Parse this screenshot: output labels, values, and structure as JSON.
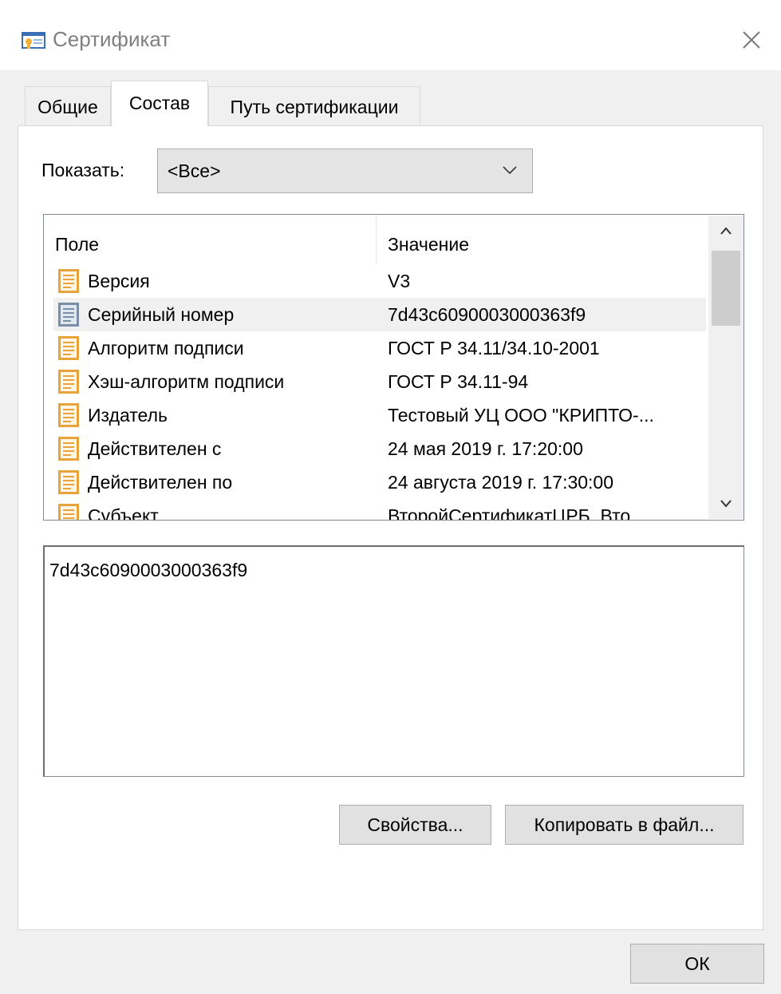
{
  "window": {
    "title": "Сертификат",
    "app_icon": "certificate-icon",
    "close_icon": "close-icon"
  },
  "tabs": [
    {
      "label": "Общие",
      "active": false
    },
    {
      "label": "Состав",
      "active": true
    },
    {
      "label": "Путь сертификации",
      "active": false
    }
  ],
  "show": {
    "label": "Показать:",
    "selected": "<Все>"
  },
  "table": {
    "columns": [
      "Поле",
      "Значение"
    ],
    "rows": [
      {
        "field": "Версия",
        "value": "V3",
        "selected": false
      },
      {
        "field": "Серийный номер",
        "value": "7d43c6090003000363f9",
        "selected": true
      },
      {
        "field": "Алгоритм подписи",
        "value": "ГОСТ Р 34.11/34.10-2001",
        "selected": false
      },
      {
        "field": "Хэш-алгоритм подписи",
        "value": "ГОСТ Р 34.11-94",
        "selected": false
      },
      {
        "field": "Издатель",
        "value": "Тестовый УЦ ООО \"КРИПТО-...",
        "selected": false
      },
      {
        "field": "Действителен с",
        "value": "24 мая 2019 г. 17:20:00",
        "selected": false
      },
      {
        "field": "Действителен по",
        "value": "24 августа 2019 г. 17:30:00",
        "selected": false
      },
      {
        "field": "Субъект",
        "value": "ВторойСертификатЦРБ, Вто...",
        "selected": false
      }
    ]
  },
  "detail": {
    "value": "7d43c6090003000363f9"
  },
  "buttons": {
    "properties": "Свойства...",
    "copy_to_file": "Копировать в файл...",
    "ok": "ОК"
  },
  "colors": {
    "window_bg": "#f0f0f0",
    "panel_bg": "#ffffff",
    "selected_row": "#f0f0f0",
    "field_icon": "#e8a33d"
  }
}
